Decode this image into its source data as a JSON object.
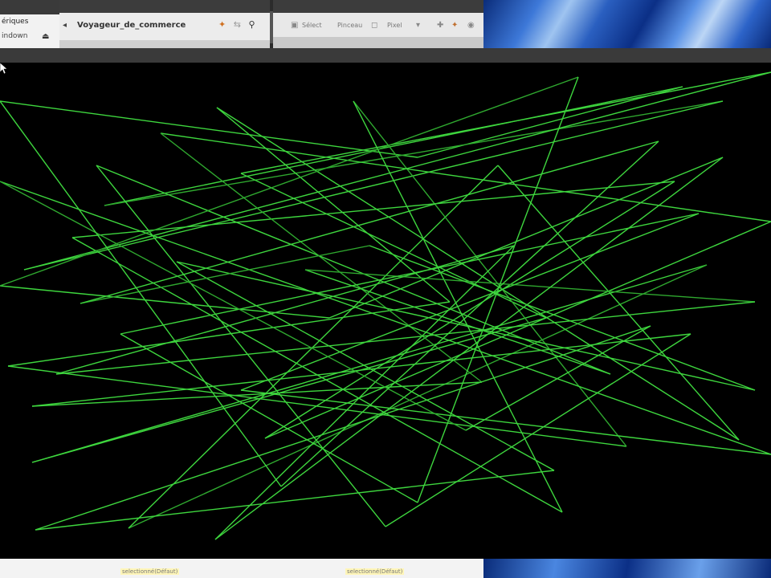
{
  "window": {
    "left_pane": {
      "line1": "ériques",
      "line2": "indown"
    },
    "tab": {
      "title": "Voyageur_de_commerce"
    },
    "toolbar2": {
      "items": [
        "Sélect",
        "Pinceau",
        "Pixel"
      ]
    }
  },
  "colors": {
    "canvas_background": "#000000",
    "path_stroke": "#3ed63e",
    "path_stroke_faint": "#2fa82f"
  },
  "icons": [
    "chevron-left-icon",
    "tool-icon",
    "search-icon",
    "mouse-pointer-icon"
  ],
  "footer": {
    "left_text": "selectionné(Défaut)",
    "right_text": "selectionné(Défaut)"
  }
}
